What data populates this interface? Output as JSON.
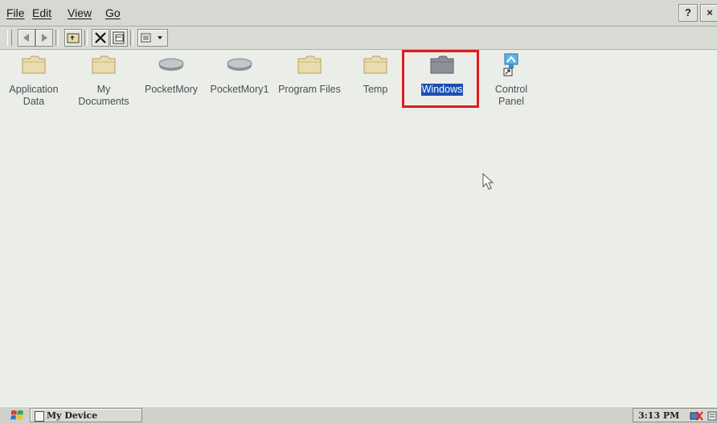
{
  "menu": {
    "file": "File",
    "edit": "Edit",
    "view": "View",
    "go": "Go"
  },
  "window_buttons": {
    "help": "?",
    "close": "×"
  },
  "items": [
    {
      "label": "Application\nData",
      "icon": "folder-icon"
    },
    {
      "label": "My\nDocuments",
      "icon": "folder-icon"
    },
    {
      "label": "PocketMory",
      "icon": "storage-card-icon"
    },
    {
      "label": "PocketMory1",
      "icon": "storage-card-icon"
    },
    {
      "label": "Program Files",
      "icon": "folder-icon"
    },
    {
      "label": "Temp",
      "icon": "folder-icon"
    },
    {
      "label": "Windows",
      "icon": "folder-icon",
      "selected": true
    },
    {
      "label": "Control\nPanel",
      "icon": "control-panel-shortcut-icon"
    }
  ],
  "taskbar": {
    "task_label": "My Device",
    "clock": "3:13 PM"
  },
  "colors": {
    "selection": "#1c4fb5",
    "highlight_box": "#e21b1b",
    "folder": "#e6d8a8"
  }
}
